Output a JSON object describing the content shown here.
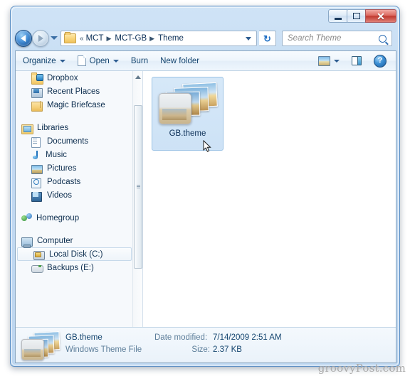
{
  "window": {
    "controls": {
      "minimize": "Minimize",
      "maximize": "Restore",
      "close": "✕"
    }
  },
  "addressbar": {
    "back_label": "Back",
    "forward_label": "Forward",
    "recent_label": "Recent pages",
    "chevrons": "«",
    "crumbs": [
      "MCT",
      "MCT-GB",
      "Theme"
    ],
    "separator": "▶",
    "refresh_label": "↻",
    "dropdown_label": "Previous locations"
  },
  "search": {
    "placeholder": "Search Theme",
    "value": ""
  },
  "toolbar": {
    "organize_label": "Organize",
    "open_label": "Open",
    "burn_label": "Burn",
    "new_folder_label": "New folder",
    "view_label": "Change your view",
    "preview_label": "Show the preview pane",
    "help_label": "?"
  },
  "sidebar": {
    "items": [
      {
        "label": "Dropbox",
        "icon": "folder-sync-icon",
        "level": "child",
        "selected": false
      },
      {
        "label": "Recent Places",
        "icon": "recent-places-icon",
        "level": "child",
        "selected": false
      },
      {
        "label": "Magic Briefcase",
        "icon": "briefcase-icon",
        "level": "child",
        "selected": false
      },
      {
        "label": "Libraries",
        "icon": "libraries-icon",
        "level": "header",
        "selected": false
      },
      {
        "label": "Documents",
        "icon": "documents-icon",
        "level": "child",
        "selected": false
      },
      {
        "label": "Music",
        "icon": "music-icon",
        "level": "child",
        "selected": false
      },
      {
        "label": "Pictures",
        "icon": "pictures-icon",
        "level": "child",
        "selected": false
      },
      {
        "label": "Podcasts",
        "icon": "podcasts-icon",
        "level": "child",
        "selected": false
      },
      {
        "label": "Videos",
        "icon": "videos-icon",
        "level": "child",
        "selected": false
      },
      {
        "label": "Homegroup",
        "icon": "homegroup-icon",
        "level": "header",
        "selected": false
      },
      {
        "label": "Computer",
        "icon": "computer-icon",
        "level": "header",
        "selected": false
      },
      {
        "label": "Local Disk (C:)",
        "icon": "local-disk-icon",
        "level": "child",
        "selected": true
      },
      {
        "label": "Backups (E:)",
        "icon": "drive-icon",
        "level": "child",
        "selected": false
      }
    ],
    "scroll_up_label": "▲",
    "scroll_down_label": "▼"
  },
  "content": {
    "files": [
      {
        "name": "GB.theme",
        "icon": "theme-thumbnail-icon",
        "selected": true
      }
    ]
  },
  "statusbar": {
    "file_name": "GB.theme",
    "file_type": "Windows Theme File",
    "date_modified_label": "Date modified:",
    "date_modified_value": "7/14/2009 2:51 AM",
    "size_label": "Size:",
    "size_value": "2.37 KB"
  },
  "watermark": {
    "text": "groovyPost.com"
  },
  "colors": {
    "frame": "#bcd6f0",
    "frame_border": "#5c8fc4",
    "close_red": "#c0392f",
    "selection_blue": "#cde2f6",
    "selection_border": "#9cc3e5",
    "text_blue": "#14456f"
  }
}
